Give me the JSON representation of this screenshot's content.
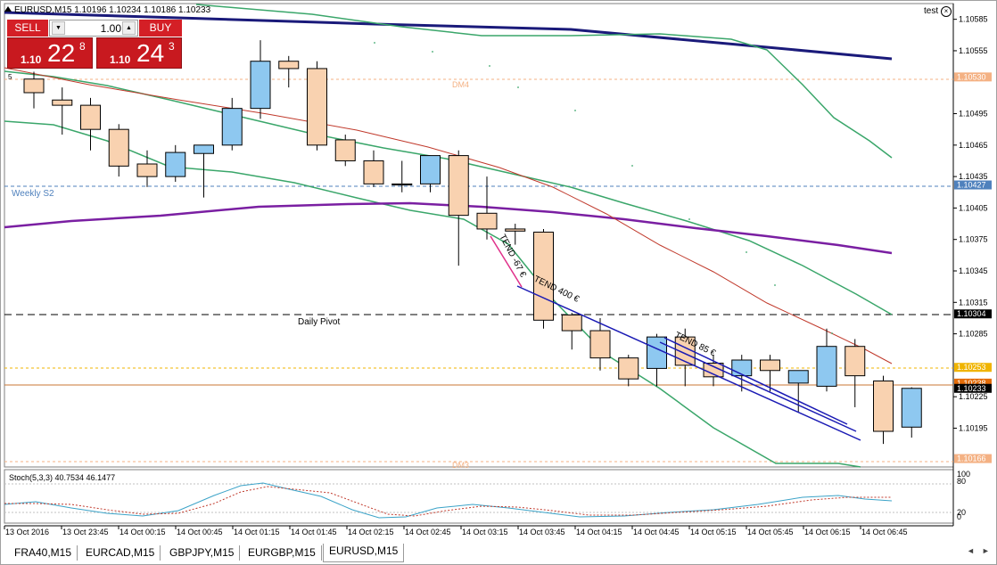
{
  "window": {
    "symbol_title": "EURUSD,M15  1.10196 1.10234 1.10186 1.10233",
    "account_label": "test",
    "close_icon": "close-circle-icon"
  },
  "trade_panel": {
    "sell_label": "SELL",
    "buy_label": "BUY",
    "lot_value": "1.00",
    "sell_price_prefix": "1.10",
    "sell_price_big": "22",
    "sell_price_sup": "8",
    "buy_price_prefix": "1.10",
    "buy_price_big": "24",
    "buy_price_sup": "3",
    "colors": {
      "button": "#d41f26",
      "box": "#c8191f"
    }
  },
  "chart_labels": {
    "weekly_s2": "Weekly S2",
    "daily_pivot": "Daily Pivot",
    "dm4": "DM4",
    "dm3": "DM3",
    "tend_1": "TEND -67 €",
    "tend_2": "TEND 400 €",
    "tend_3": "TEND 85 €",
    "label_5": "5"
  },
  "price_axis": {
    "ticks": [
      "1.10585",
      "1.10555",
      "1.10495",
      "1.10465",
      "1.10435",
      "1.10405",
      "1.10375",
      "1.10345",
      "1.10315",
      "1.10285",
      "1.10225",
      "1.10195"
    ],
    "badges": [
      {
        "text": "1.10530",
        "color": "#f4b183"
      },
      {
        "text": "1.10427",
        "color": "#4f81bd"
      },
      {
        "text": "1.10304",
        "color": "#000000"
      },
      {
        "text": "1.10253",
        "color": "#f0b400"
      },
      {
        "text": "1.10238",
        "color": "#e36c09"
      },
      {
        "text": "1.10233",
        "color": "#000000"
      },
      {
        "text": "1.10166",
        "color": "#f4b183"
      }
    ]
  },
  "time_axis": [
    "13 Oct 2016",
    "13 Oct 23:45",
    "14 Oct 00:15",
    "14 Oct 00:45",
    "14 Oct 01:15",
    "14 Oct 01:45",
    "14 Oct 02:15",
    "14 Oct 02:45",
    "14 Oct 03:15",
    "14 Oct 03:45",
    "14 Oct 04:15",
    "14 Oct 04:45",
    "14 Oct 05:15",
    "14 Oct 05:45",
    "14 Oct 06:15",
    "14 Oct 06:45"
  ],
  "stoch": {
    "title": "Stoch(5,3,3) 40.7534 46.1477",
    "levels": [
      "100",
      "80",
      "20",
      "0"
    ]
  },
  "tabs": [
    "FRA40,M15",
    "EURCAD,M15",
    "GBPJPY,M15",
    "EURGBP,M15",
    "EURUSD,M15"
  ],
  "active_tab": "EURUSD,M15",
  "chart_data": {
    "type": "candlestick",
    "colors": {
      "bull": "#8ec8f0",
      "bear": "#f9d2b0",
      "ma_navy": "#1a1a7a",
      "ma_green": "#3aa66a",
      "ma_purple": "#7a1fa2",
      "ma_red": "#c0392b"
    },
    "candles": [
      {
        "o": 1.10528,
        "h": 1.10535,
        "l": 1.105,
        "c": 1.10515
      },
      {
        "o": 1.10508,
        "h": 1.1052,
        "l": 1.10475,
        "c": 1.10503
      },
      {
        "o": 1.10503,
        "h": 1.1051,
        "l": 1.1046,
        "c": 1.1048
      },
      {
        "o": 1.1048,
        "h": 1.10485,
        "l": 1.10435,
        "c": 1.10445
      },
      {
        "o": 1.10447,
        "h": 1.1046,
        "l": 1.10425,
        "c": 1.10435
      },
      {
        "o": 1.10435,
        "h": 1.10465,
        "l": 1.1043,
        "c": 1.10458
      },
      {
        "o": 1.10457,
        "h": 1.10465,
        "l": 1.10415,
        "c": 1.10465
      },
      {
        "o": 1.10465,
        "h": 1.1051,
        "l": 1.1046,
        "c": 1.105
      },
      {
        "o": 1.105,
        "h": 1.10565,
        "l": 1.1049,
        "c": 1.10545
      },
      {
        "o": 1.10545,
        "h": 1.1055,
        "l": 1.1052,
        "c": 1.10538
      },
      {
        "o": 1.10538,
        "h": 1.10545,
        "l": 1.1046,
        "c": 1.10465
      },
      {
        "o": 1.1047,
        "h": 1.10475,
        "l": 1.10445,
        "c": 1.1045
      },
      {
        "o": 1.1045,
        "h": 1.1046,
        "l": 1.10425,
        "c": 1.10428
      },
      {
        "o": 1.10428,
        "h": 1.1045,
        "l": 1.1042,
        "c": 1.10427
      },
      {
        "o": 1.10428,
        "h": 1.1045,
        "l": 1.1042,
        "c": 1.10455
      },
      {
        "o": 1.10455,
        "h": 1.1046,
        "l": 1.1035,
        "c": 1.10398
      },
      {
        "o": 1.104,
        "h": 1.10435,
        "l": 1.10375,
        "c": 1.10385
      },
      {
        "o": 1.10385,
        "h": 1.1039,
        "l": 1.1037,
        "c": 1.10383
      },
      {
        "o": 1.10382,
        "h": 1.10385,
        "l": 1.1029,
        "c": 1.10298
      },
      {
        "o": 1.10303,
        "h": 1.10305,
        "l": 1.1027,
        "c": 1.10288
      },
      {
        "o": 1.10288,
        "h": 1.103,
        "l": 1.1025,
        "c": 1.10262
      },
      {
        "o": 1.10262,
        "h": 1.10265,
        "l": 1.10235,
        "c": 1.10242
      },
      {
        "o": 1.10252,
        "h": 1.10285,
        "l": 1.10235,
        "c": 1.10282
      },
      {
        "o": 1.10282,
        "h": 1.1029,
        "l": 1.10235,
        "c": 1.10255
      },
      {
        "o": 1.10257,
        "h": 1.10265,
        "l": 1.10235,
        "c": 1.10244
      },
      {
        "o": 1.10245,
        "h": 1.10265,
        "l": 1.1023,
        "c": 1.1026
      },
      {
        "o": 1.1026,
        "h": 1.10265,
        "l": 1.1023,
        "c": 1.1025
      },
      {
        "o": 1.10238,
        "h": 1.1025,
        "l": 1.1021,
        "c": 1.1025
      },
      {
        "o": 1.10235,
        "h": 1.1029,
        "l": 1.1023,
        "c": 1.10273
      },
      {
        "o": 1.10273,
        "h": 1.1028,
        "l": 1.10215,
        "c": 1.10245
      },
      {
        "o": 1.1024,
        "h": 1.10245,
        "l": 1.1018,
        "c": 1.10192
      },
      {
        "o": 1.10196,
        "h": 1.10234,
        "l": 1.10186,
        "c": 1.10233
      }
    ],
    "price_axis_range": [
      1.10158,
      1.106
    ]
  }
}
